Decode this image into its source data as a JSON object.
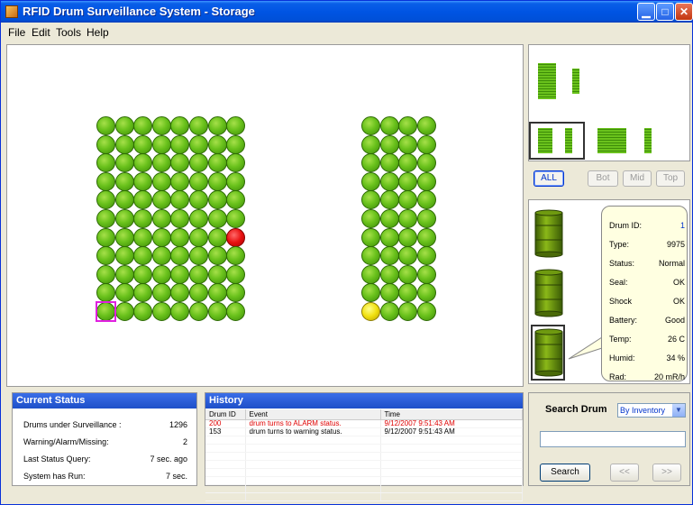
{
  "window": {
    "title": "RFID Drum Surveillance System - Storage"
  },
  "menu": {
    "items": [
      "File",
      "Edit",
      "Tools",
      "Help"
    ]
  },
  "level_buttons": {
    "all": "ALL",
    "bot": "Bot",
    "mid": "Mid",
    "top": "Top"
  },
  "drum_info": {
    "rows": [
      {
        "label": "Drum ID:",
        "value": "1"
      },
      {
        "label": "Type:",
        "value": "9975"
      },
      {
        "label": "Status:",
        "value": "Normal"
      },
      {
        "label": "Seal:",
        "value": "OK"
      },
      {
        "label": "Shock",
        "value": "OK"
      },
      {
        "label": "Battery:",
        "value": "Good"
      },
      {
        "label": "Temp:",
        "value": "26 C"
      },
      {
        "label": "Humid:",
        "value": "34 %"
      },
      {
        "label": "Rad:",
        "value": "20 mR/h"
      }
    ]
  },
  "current_status": {
    "title": "Current Status",
    "rows": [
      {
        "label": "Drums under Surveillance :",
        "value": "1296"
      },
      {
        "label": "Warning/Alarm/Missing:",
        "value": "2"
      },
      {
        "label": "Last Status Query:",
        "value": "7 sec. ago"
      },
      {
        "label": "System has Run:",
        "value": "7 sec."
      }
    ]
  },
  "history": {
    "title": "History",
    "columns": [
      "Drum ID",
      "Event",
      "Time"
    ],
    "rows": [
      {
        "drum_id": "200",
        "event": "drum turns to ALARM status.",
        "time": "9/12/2007 9:51:43 AM",
        "alarm": true
      },
      {
        "drum_id": "153",
        "event": "drum turns to warning status.",
        "time": "9/12/2007 9:51:43 AM",
        "alarm": false
      }
    ]
  },
  "search": {
    "title": "Search Drum",
    "mode": "By Inventory",
    "input_value": "",
    "search_label": "Search",
    "prev_label": "<<",
    "next_label": ">>"
  },
  "storage_map": {
    "groups": [
      {
        "name": "left-block",
        "cols": 8,
        "rows": 11
      },
      {
        "name": "right-block",
        "cols": 4,
        "rows": 11
      }
    ],
    "alarm_drums": [
      {
        "group": 0,
        "col": 7,
        "row": 6
      }
    ],
    "warning_drums": [
      {
        "group": 1,
        "col": 0,
        "row": 10
      }
    ],
    "selected_drum": {
      "group": 0,
      "col": 0,
      "row": 10
    }
  },
  "colors": {
    "normal": "#6ac21c",
    "alarm": "#e81010",
    "warning": "#f0e010",
    "selection": "#e020e0",
    "header_blue": "#1e4fc8"
  }
}
